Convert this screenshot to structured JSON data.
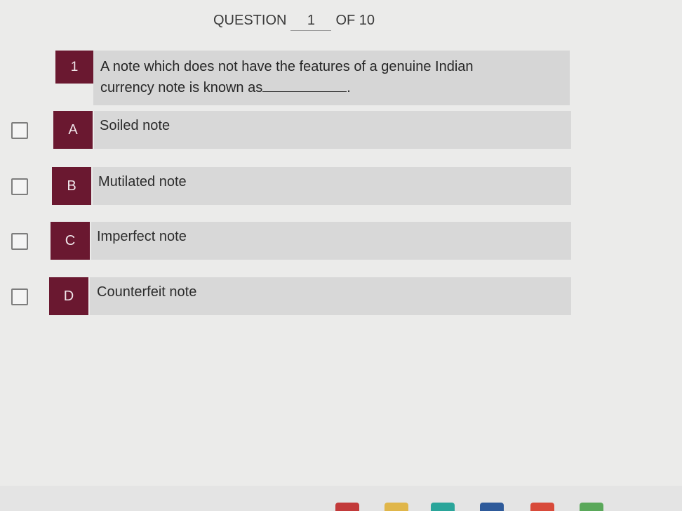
{
  "header": {
    "label": "QUESTION",
    "current": "1",
    "total_label": "OF 10"
  },
  "question": {
    "number": "1",
    "text_line1": "A note which does not have the features of a genuine Indian",
    "text_line2": "currency note is known as",
    "text_end": "."
  },
  "options": [
    {
      "letter": "A",
      "text": "Soiled note"
    },
    {
      "letter": "B",
      "text": "Mutilated note"
    },
    {
      "letter": "C",
      "text": "Imperfect note"
    },
    {
      "letter": "D",
      "text": "Counterfeit note"
    }
  ],
  "colors": {
    "badge": "#6a1830",
    "option_box": "#d8d8d8",
    "background": "#ebebea"
  }
}
